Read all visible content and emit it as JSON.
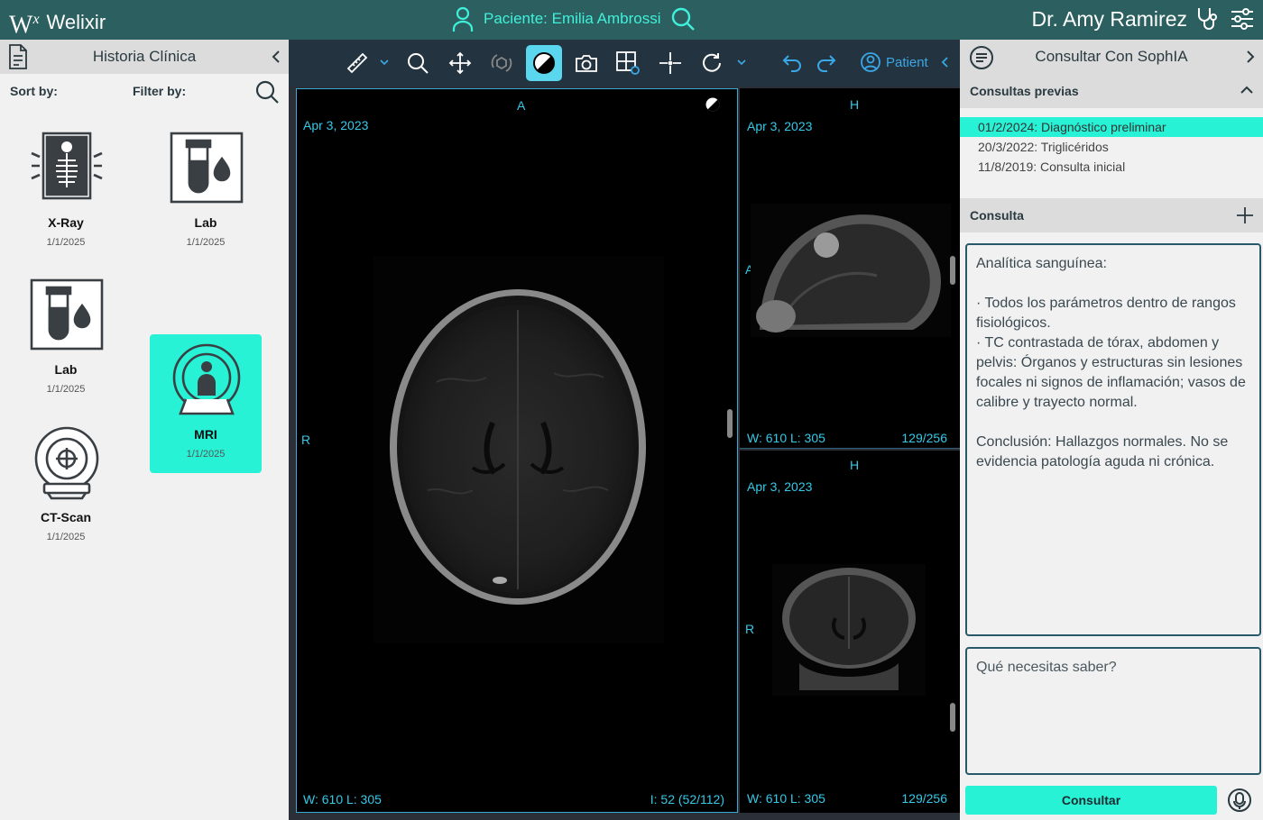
{
  "header": {
    "brand_logo": "W",
    "brand_logo_sup": "x",
    "brand_name": "Welixir",
    "patient_label": "Paciente: Emilia Ambrossi",
    "doctor_name": "Dr. Amy Ramirez"
  },
  "left_panel": {
    "title": "Historia Clínica",
    "sort_label": "Sort by:",
    "filter_label": "Filter by:",
    "studies": [
      {
        "name": "X-Ray",
        "date": "1/1/2025",
        "icon": "xray-icon",
        "selected": false
      },
      {
        "name": "Lab",
        "date": "1/1/2025",
        "icon": "lab-icon",
        "selected": false
      },
      {
        "name": "Lab",
        "date": "1/1/2025",
        "icon": "lab-icon",
        "selected": false
      },
      {
        "name": "MRI",
        "date": "1/1/2025",
        "icon": "mri-icon",
        "selected": true
      },
      {
        "name": "CT-Scan",
        "date": "1/1/2025",
        "icon": "ct-scan-icon",
        "selected": false
      }
    ]
  },
  "toolbar": {
    "patient_label": "Patient",
    "active_tool": "contrast"
  },
  "viewports": {
    "main": {
      "date": "Apr 3, 2023",
      "top": "A",
      "left": "R",
      "wl": "W: 610   L: 305",
      "index": "I: 52 (52/112)"
    },
    "side1": {
      "date": "Apr 3, 2023",
      "top": "H",
      "left": "A",
      "wl": "W: 610   L: 305",
      "index": "129/256"
    },
    "side2": {
      "date": "Apr 3, 2023",
      "top": "H",
      "left": "R",
      "wl": "W: 610   L: 305",
      "index": "129/256"
    }
  },
  "right_panel": {
    "title": "Consultar Con SophIA",
    "prev_section": "Consultas previas",
    "previous": [
      "01/2/2024: Diagnóstico preliminar",
      "20/3/2022: Triglicéridos",
      "11/8/2019: Consulta inicial"
    ],
    "consult_section": "Consulta",
    "consult_text": [
      "Analítica sanguínea:",
      "",
      "· Todos los parámetros dentro de rangos fisiológicos.",
      "· TC contrastada de tórax, abdomen y pelvis: Órganos y estructuras sin lesiones focales ni signos de inflamación; vasos de calibre y trayecto normal.",
      "",
      "Conclusión: Hallazgos normales. No se evidencia patología aguda ni crónica."
    ],
    "question_placeholder": "Qué necesitas saber?",
    "submit_label": "Consultar"
  },
  "colors": {
    "header": "#2c5f5f",
    "accent": "#27f2d6",
    "viewer_text": "#36c9e8",
    "toolbar": "#233440"
  }
}
